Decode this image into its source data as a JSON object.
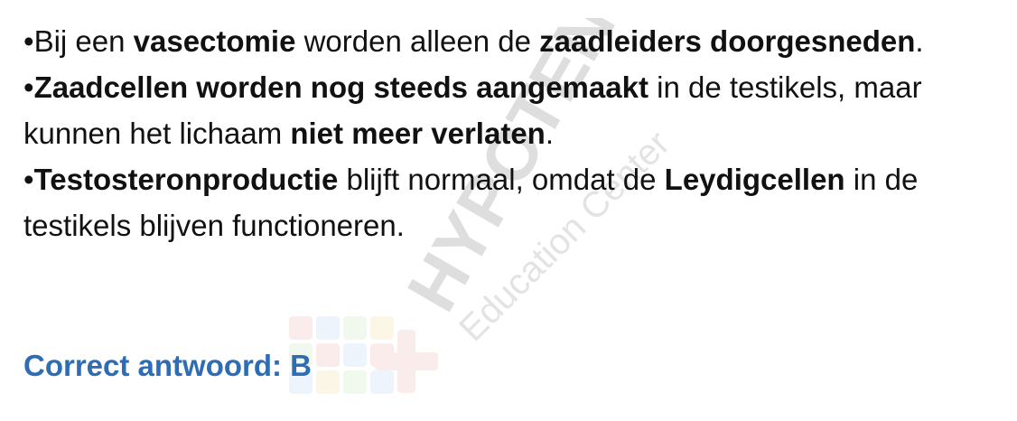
{
  "bullets": [
    {
      "marker": "•",
      "segments": [
        {
          "text": "Bij een ",
          "bold": false
        },
        {
          "text": "vasectomie",
          "bold": true
        },
        {
          "text": " worden alleen de ",
          "bold": false
        },
        {
          "text": "zaadleiders doorgesneden",
          "bold": true
        },
        {
          "text": ".",
          "bold": false
        }
      ]
    },
    {
      "marker": "•",
      "segments": [
        {
          "text": "Zaadcellen worden nog steeds aangemaakt",
          "bold": true
        },
        {
          "text": " in de testikels, maar kunnen het lichaam ",
          "bold": false
        },
        {
          "text": "niet meer verlaten",
          "bold": true
        },
        {
          "text": ".",
          "bold": false
        }
      ]
    },
    {
      "marker": "•",
      "segments": [
        {
          "text": "Testosteronproductie",
          "bold": true
        },
        {
          "text": " blijft normaal, omdat de ",
          "bold": false
        },
        {
          "text": "Leydigcellen",
          "bold": true
        },
        {
          "text": " in de testikels blijven functioneren.",
          "bold": false
        }
      ]
    }
  ],
  "answer": "Correct antwoord: B",
  "watermark": {
    "brand": "HYPOTENUSE",
    "subtitle": "Education Center"
  },
  "colors": {
    "answer": "#2E6DB4",
    "text": "#111111"
  }
}
